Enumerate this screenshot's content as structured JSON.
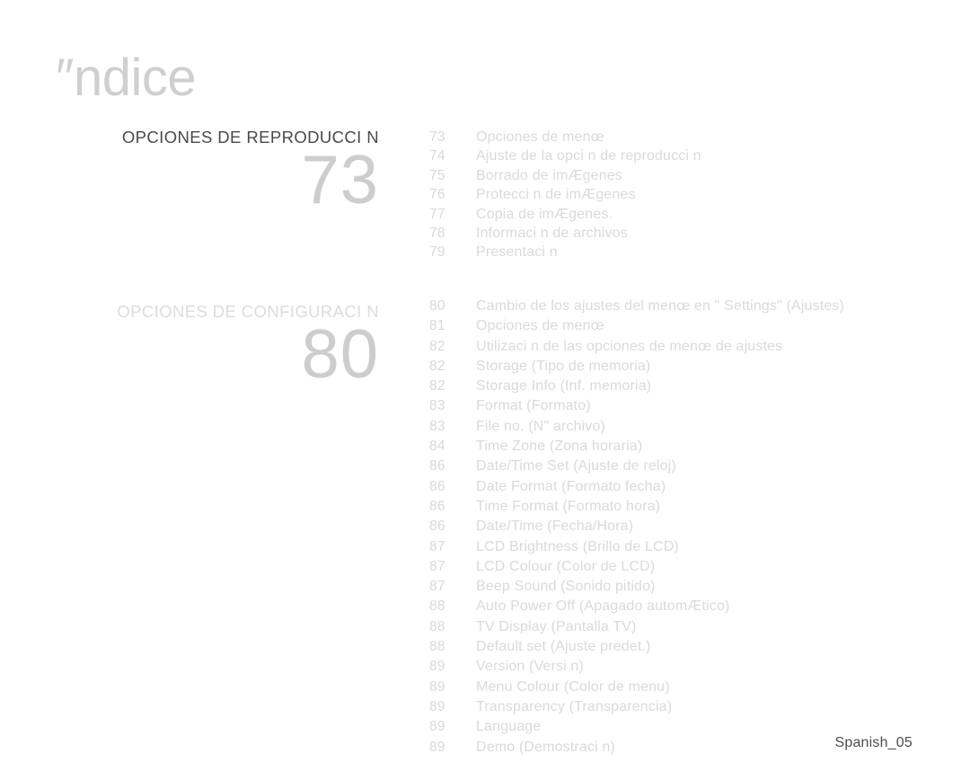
{
  "document": {
    "title": "″ndice",
    "footer_label": "Spanish_05"
  },
  "sections": [
    {
      "heading": "OPCIONES DE REPRODUCCI N",
      "big_number": "73",
      "heading_tone": "dark",
      "entries": [
        {
          "page": "73",
          "label": "Opciones de menœ"
        },
        {
          "page": "74",
          "label": "Ajuste de la opci n de reproducci n"
        },
        {
          "page": "75",
          "label": "Borrado de imÆgenes"
        },
        {
          "page": "76",
          "label": "Protecci n de imÆgenes"
        },
        {
          "page": "77",
          "label": "Copia de imÆgenes."
        },
        {
          "page": "78",
          "label": "Informaci n de archivos"
        },
        {
          "page": "79",
          "label": "Presentaci n"
        }
      ]
    },
    {
      "heading": "OPCIONES DE CONFIGURACI N",
      "big_number": "80",
      "heading_tone": "light",
      "entries": [
        {
          "page": "80",
          "label": "Cambio de los ajustes del menœ en \" Settings\" (Ajustes)"
        },
        {
          "page": "81",
          "label": "Opciones de menœ"
        },
        {
          "page": "82",
          "label": "Utilizaci n de las opciones de menœ de ajustes"
        },
        {
          "page": "82",
          "label": "Storage (Tipo de memoria)"
        },
        {
          "page": "82",
          "label": "Storage Info (Inf. memoria)"
        },
        {
          "page": "83",
          "label": "Format (Formato)"
        },
        {
          "page": "83",
          "label": "File no. (N\" archivo)"
        },
        {
          "page": "84",
          "label": "Time Zone (Zona horaria)"
        },
        {
          "page": "86",
          "label": "Date/Time Set (Ajuste de reloj)"
        },
        {
          "page": "86",
          "label": "Date Format (Formato fecha)"
        },
        {
          "page": "86",
          "label": "Time Format (Formato hora)"
        },
        {
          "page": "86",
          "label": "Date/Time (Fecha/Hora)"
        },
        {
          "page": "87",
          "label": "LCD Brightness (Brillo de LCD)"
        },
        {
          "page": "87",
          "label": "LCD Colour (Color de LCD)"
        },
        {
          "page": "87",
          "label": "Beep Sound (Sonido pitido)"
        },
        {
          "page": "88",
          "label": "Auto Power Off (Apagado automÆtico)"
        },
        {
          "page": "88",
          "label": "TV Display (Pantalla TV)"
        },
        {
          "page": "88",
          "label": "Default set (Ajuste predet.)"
        },
        {
          "page": "89",
          "label": "Version (Versi n)"
        },
        {
          "page": "89",
          "label": "Menu Colour (Color de menu)"
        },
        {
          "page": "89",
          "label": "Transparency (Transparencia)"
        },
        {
          "page": "89",
          "label": "Language"
        },
        {
          "page": "89",
          "label": "Demo (Demostraci n)"
        }
      ]
    }
  ]
}
